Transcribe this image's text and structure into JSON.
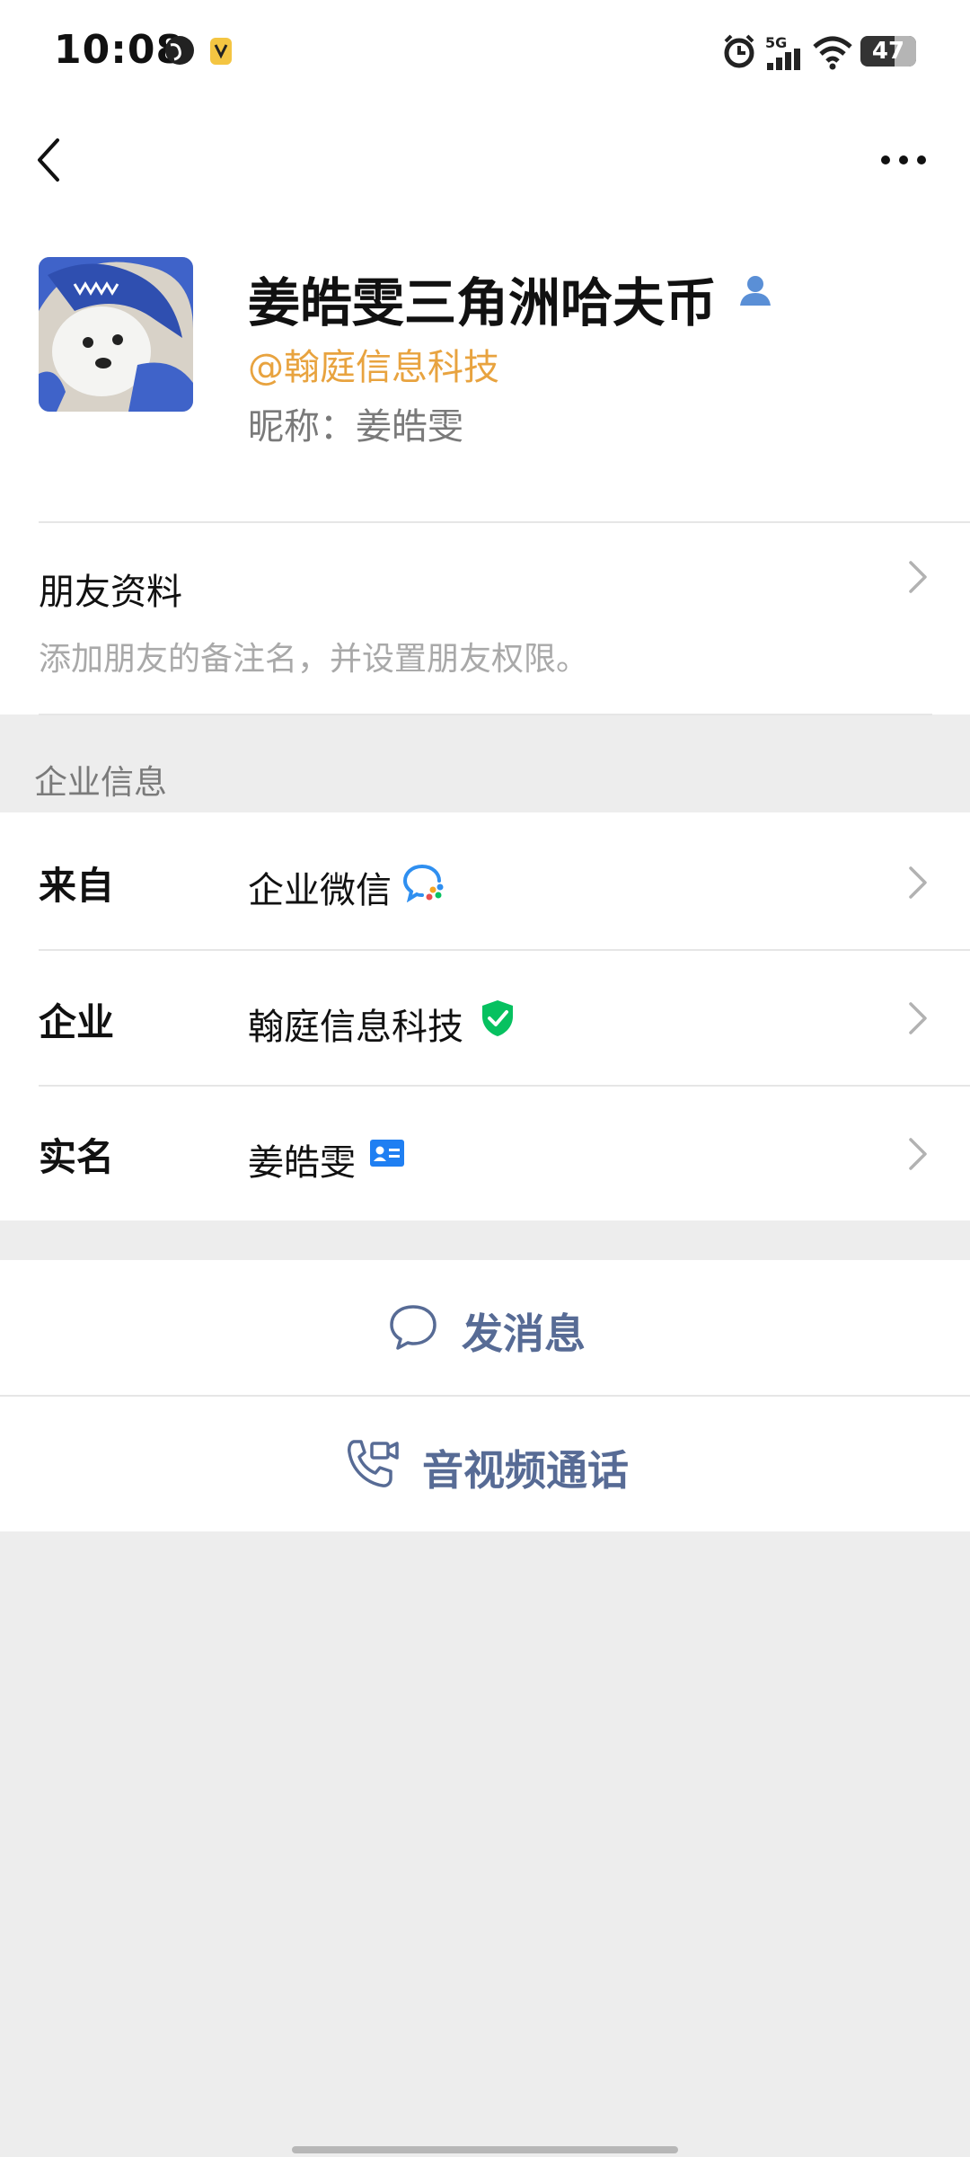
{
  "status_bar": {
    "time": "10:08",
    "network": "5G",
    "battery": "47"
  },
  "nav": {
    "back_icon": "chevron-left-icon",
    "more_icon": "more-horizontal-icon"
  },
  "profile": {
    "display_name": "姜皓雯三角洲哈夫币",
    "company_tag": "@翰庭信息科技",
    "nickname": "昵称：姜皓雯"
  },
  "friend_info": {
    "title": "朋友资料",
    "subtitle": "添加朋友的备注名，并设置朋友权限。"
  },
  "enterprise": {
    "section_label": "企业信息",
    "rows": [
      {
        "label": "来自",
        "value": "企业微信",
        "icon": "wecom-icon"
      },
      {
        "label": "企业",
        "value": "翰庭信息科技",
        "icon": "verified-shield-icon"
      },
      {
        "label": "实名",
        "value": "姜皓雯",
        "icon": "id-card-icon"
      }
    ]
  },
  "actions": {
    "message": "发消息",
    "call": "音视频通话"
  },
  "colors": {
    "accent_link": "#576b95",
    "company_orange": "#e8a33f",
    "verified_green": "#07c160",
    "background": "#ededed"
  }
}
